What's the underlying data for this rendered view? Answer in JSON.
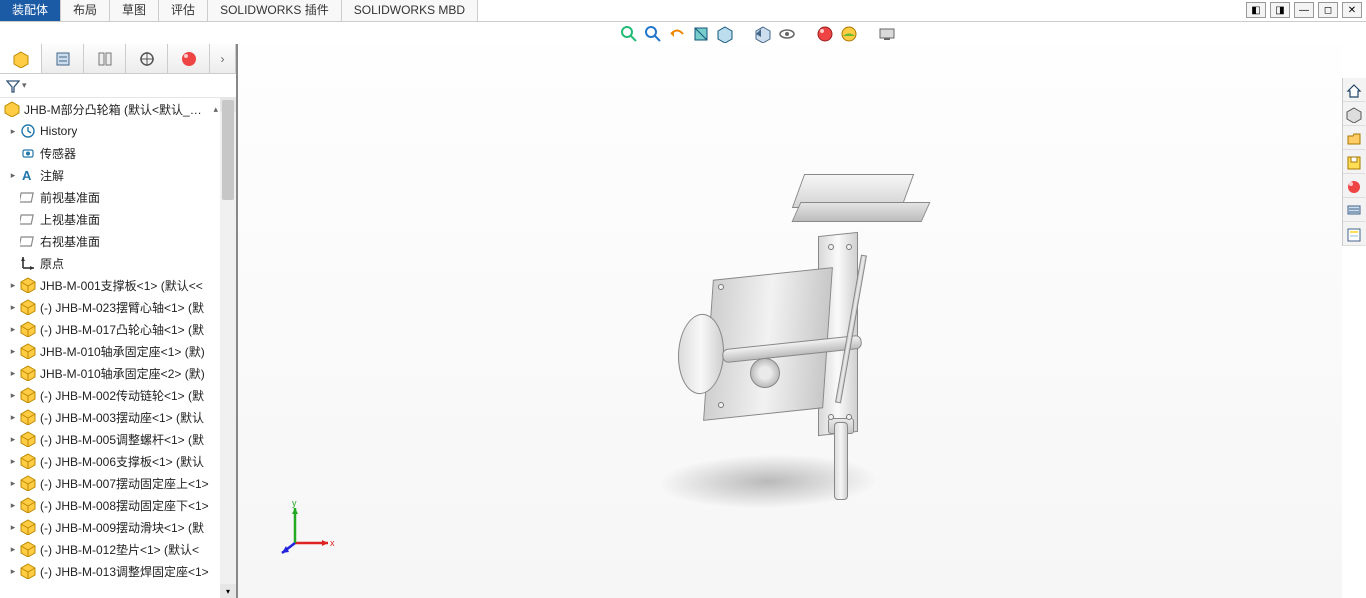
{
  "menu": {
    "tabs": [
      "装配体",
      "布局",
      "草图",
      "评估",
      "SOLIDWORKS 插件",
      "SOLIDWORKS MBD"
    ],
    "active_index": 0
  },
  "top_toolbar": {
    "icons": [
      "zoom-area-icon",
      "zoom-fit-icon",
      "previous-view-icon",
      "section-view-icon",
      "view-orient-icon",
      "display-style-icon",
      "hide-show-icon",
      "appearance-icon",
      "scene-icon",
      "view-settings-icon"
    ]
  },
  "window_controls": [
    "◧",
    "◨",
    "—",
    "◻",
    "✕"
  ],
  "panel_tabs": {
    "icons": [
      "assembly-icon",
      "properties-icon",
      "config-icon",
      "display-manager-icon",
      "appearances-icon"
    ]
  },
  "assembly": {
    "root": "JHB-M部分凸轮箱   (默认<默认_显示",
    "nodes": [
      {
        "expander": "▸",
        "icon": "history-icon",
        "label": "History"
      },
      {
        "expander": "",
        "icon": "sensor-icon",
        "label": "传感器"
      },
      {
        "expander": "▸",
        "icon": "annotation-icon",
        "label": "注解"
      },
      {
        "expander": "",
        "icon": "plane-icon",
        "label": "前视基准面"
      },
      {
        "expander": "",
        "icon": "plane-icon",
        "label": "上视基准面"
      },
      {
        "expander": "",
        "icon": "plane-icon",
        "label": "右视基准面"
      },
      {
        "expander": "",
        "icon": "origin-icon",
        "label": "原点"
      },
      {
        "expander": "▸",
        "icon": "part-icon",
        "label": "JHB-M-001支撑板<1> (默认<<"
      },
      {
        "expander": "▸",
        "icon": "part-icon",
        "label": "(-) JHB-M-023摆臂心轴<1> (默"
      },
      {
        "expander": "▸",
        "icon": "part-icon",
        "label": "(-) JHB-M-017凸轮心轴<1> (默"
      },
      {
        "expander": "▸",
        "icon": "part-icon",
        "label": "JHB-M-010轴承固定座<1> (默)"
      },
      {
        "expander": "▸",
        "icon": "part-icon",
        "label": "JHB-M-010轴承固定座<2> (默)"
      },
      {
        "expander": "▸",
        "icon": "part-icon",
        "label": "(-) JHB-M-002传动链轮<1> (默"
      },
      {
        "expander": "▸",
        "icon": "part-icon",
        "label": "(-) JHB-M-003摆动座<1> (默认"
      },
      {
        "expander": "▸",
        "icon": "part-icon",
        "label": "(-) JHB-M-005调整螺杆<1> (默"
      },
      {
        "expander": "▸",
        "icon": "part-icon",
        "label": "(-) JHB-M-006支撑板<1> (默认"
      },
      {
        "expander": "▸",
        "icon": "part-icon",
        "label": "(-) JHB-M-007摆动固定座上<1>"
      },
      {
        "expander": "▸",
        "icon": "part-icon",
        "label": "(-) JHB-M-008摆动固定座下<1>"
      },
      {
        "expander": "▸",
        "icon": "part-icon",
        "label": "(-) JHB-M-009摆动滑块<1> (默"
      },
      {
        "expander": "▸",
        "icon": "part-icon",
        "label": "(-) JHB-M-012垫片<1> (默认<"
      },
      {
        "expander": "▸",
        "icon": "part-icon",
        "label": "(-) JHB-M-013调整焊固定座<1>"
      }
    ]
  },
  "right_toolbar": {
    "icons": [
      "home-icon",
      "part-new-icon",
      "open-icon",
      "save-icon",
      "appearances-pane-icon",
      "display-pane-icon",
      "custom-props-icon"
    ]
  },
  "triad": {
    "x": "x",
    "y": "y",
    "z": ""
  },
  "colors": {
    "active_tab": "#1b5aa5"
  }
}
